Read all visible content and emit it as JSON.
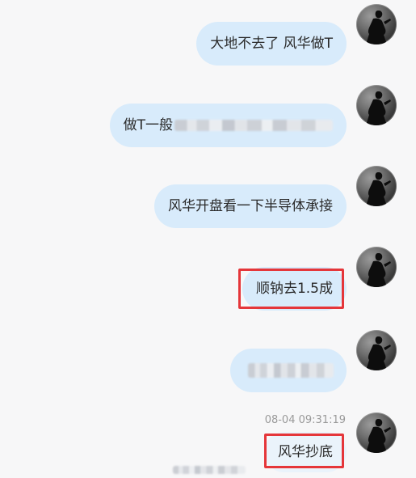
{
  "messages": [
    {
      "text": "大地不去了 风华做T"
    },
    {
      "text": "做T一般"
    },
    {
      "text": "风华开盘看一下半导体承接"
    },
    {
      "text": "顺钠去1.5成"
    },
    {
      "text": ""
    },
    {
      "text": "风华抄底"
    }
  ],
  "timestamp": "08-04 09:31:19",
  "colors": {
    "bubble": "#d8ebfb",
    "highlight": "#e5363a",
    "background": "#f7f7f8"
  },
  "icons": {
    "avatar": "user-avatar-icon"
  }
}
